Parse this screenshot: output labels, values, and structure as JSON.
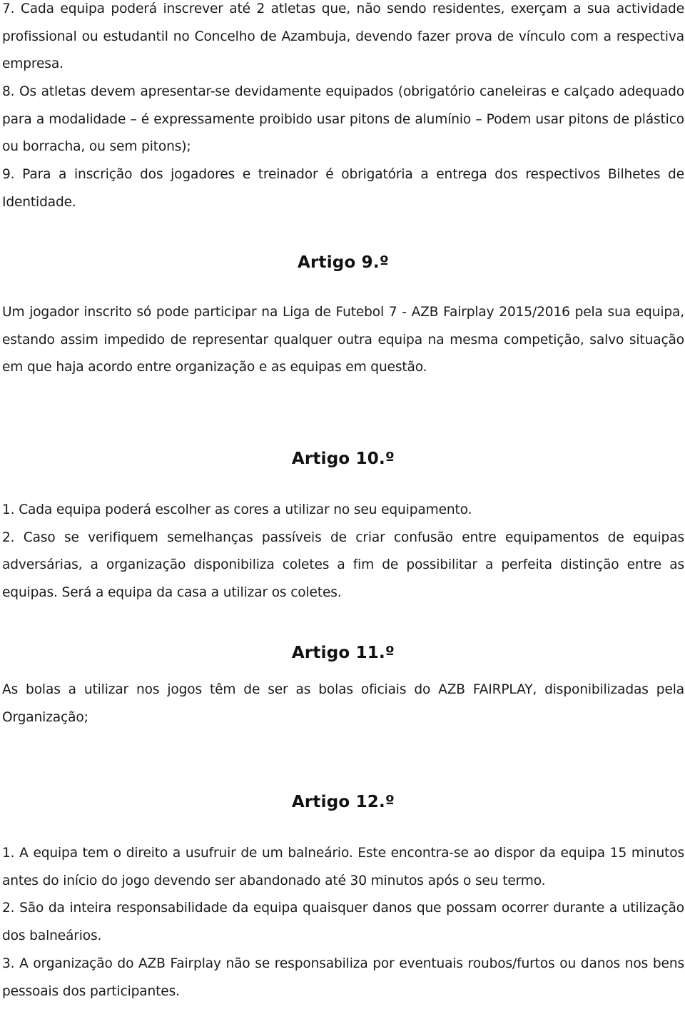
{
  "document": {
    "intro_items": [
      "7. Cada equipa poderá inscrever até 2 atletas que, não sendo residentes, exerçam a sua actividade profissional ou estudantil no Concelho de Azambuja, devendo fazer prova de vínculo com a respectiva empresa.",
      "8. Os atletas devem apresentar-se devidamente equipados (obrigatório caneleiras e calçado adequado para a modalidade – é expressamente proibido usar pitons de alumínio – Podem usar pitons de plástico ou borracha, ou sem pitons);",
      "9. Para a inscrição dos jogadores e treinador é obrigatória a entrega dos respectivos Bilhetes de Identidade."
    ],
    "articles": [
      {
        "title": "Artigo 9.º",
        "paragraphs": [
          "Um jogador inscrito só pode participar na Liga de Futebol 7 - AZB Fairplay 2015/2016 pela sua equipa, estando assim impedido de representar qualquer outra equipa na mesma competição, salvo situação em que haja acordo entre organização e as equipas em questão."
        ]
      },
      {
        "title": "Artigo 10.º",
        "paragraphs": [
          "1. Cada equipa poderá escolher as cores a utilizar no seu equipamento.",
          "2. Caso se verifiquem semelhanças passíveis de criar confusão entre equipamentos de equipas adversárias, a organização disponibiliza coletes a fim de possibilitar a perfeita distinção entre as equipas. Será a equipa da casa a utilizar os coletes."
        ]
      },
      {
        "title": "Artigo 11.º",
        "paragraphs": [
          "As bolas a utilizar nos jogos têm de ser as bolas oficiais do AZB FAIRPLAY, disponibilizadas pela Organização;"
        ]
      },
      {
        "title": "Artigo 12.º",
        "paragraphs": [
          "1. A equipa tem o direito a usufruir de um balneário. Este encontra-se ao dispor da equipa 15 minutos antes do início do jogo devendo ser abandonado até 30 minutos após o seu termo.",
          "2. São da inteira responsabilidade da equipa quaisquer danos que possam ocorrer durante a utilização dos balneários.",
          "3. A organização do AZB Fairplay não se responsabiliza por eventuais roubos/furtos ou danos nos bens pessoais dos participantes."
        ]
      }
    ]
  }
}
